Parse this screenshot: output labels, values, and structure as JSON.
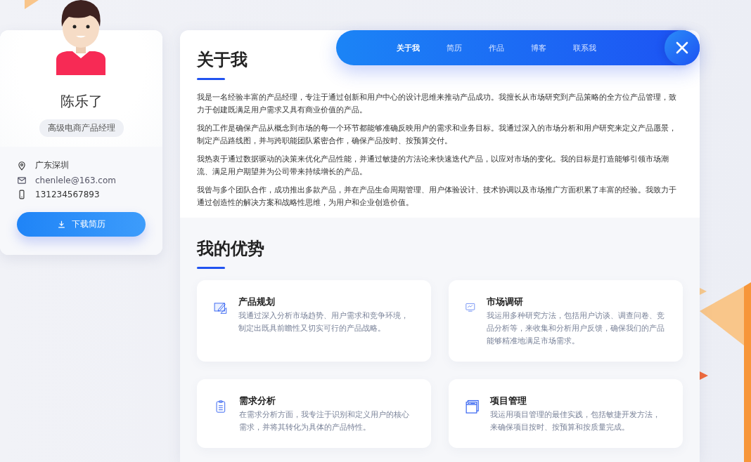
{
  "profile": {
    "name": "陈乐了",
    "title": "高级电商产品经理",
    "contacts": [
      {
        "kind": "location",
        "text": "广东深圳"
      },
      {
        "kind": "email",
        "text": "chenlele@163.com"
      },
      {
        "kind": "phone",
        "text": "131234567893"
      }
    ],
    "download_button": "下载简历"
  },
  "nav": {
    "items": [
      {
        "label": "关于我",
        "selected": true
      },
      {
        "label": "简历",
        "selected": false
      },
      {
        "label": "作品",
        "selected": false
      },
      {
        "label": "博客",
        "selected": false
      },
      {
        "label": "联系我",
        "selected": false
      }
    ]
  },
  "about": {
    "heading": "关于我",
    "paragraphs": [
      "我是一名经验丰富的产品经理，专注于通过创新和用户中心的设计思维来推动产品成功。我擅长从市场研究到产品策略的全方位产品管理，致力于创建既满足用户需求又具有商业价值的产品。",
      "我的工作是确保产品从概念到市场的每一个环节都能够准确反映用户的需求和业务目标。我通过深入的市场分析和用户研究来定义产品愿景，制定产品路线图，并与跨职能团队紧密合作，确保产品按时、按预算交付。",
      "我热衷于通过数据驱动的决策来优化产品性能，并通过敏捷的方法论来快速迭代产品，以应对市场的变化。我的目标是打造能够引领市场潮流、满足用户期望并为公司带来持续增长的产品。",
      "我曾与多个团队合作，成功推出多款产品，并在产品生命周期管理、用户体验设计、技术协调以及市场推广方面积累了丰富的经验。我致力于通过创造性的解决方案和战略性思维，为用户和企业创造价值。"
    ]
  },
  "strengths": {
    "heading": "我的优势",
    "items": [
      {
        "kind": "blueprint",
        "title": "产品规划",
        "text": "我通过深入分析市场趋势、用户需求和竞争环境，制定出既具前瞻性又切实可行的产品战略。"
      },
      {
        "kind": "monitor",
        "title": "市场调研",
        "text": "我运用多种研究方法，包括用户访谈、调查问卷、竞品分析等，来收集和分析用户反馈，确保我们的产品能够精准地满足市场需求。"
      },
      {
        "kind": "clipboard",
        "title": "需求分析",
        "text": "在需求分析方面，我专注于识别和定义用户的核心需求，并将其转化为具体的产品特性。"
      },
      {
        "kind": "windows",
        "title": "项目管理",
        "text": "我运用项目管理的最佳实践，包括敏捷开发方法，来确保项目按时、按预算和按质量完成。"
      }
    ]
  }
}
